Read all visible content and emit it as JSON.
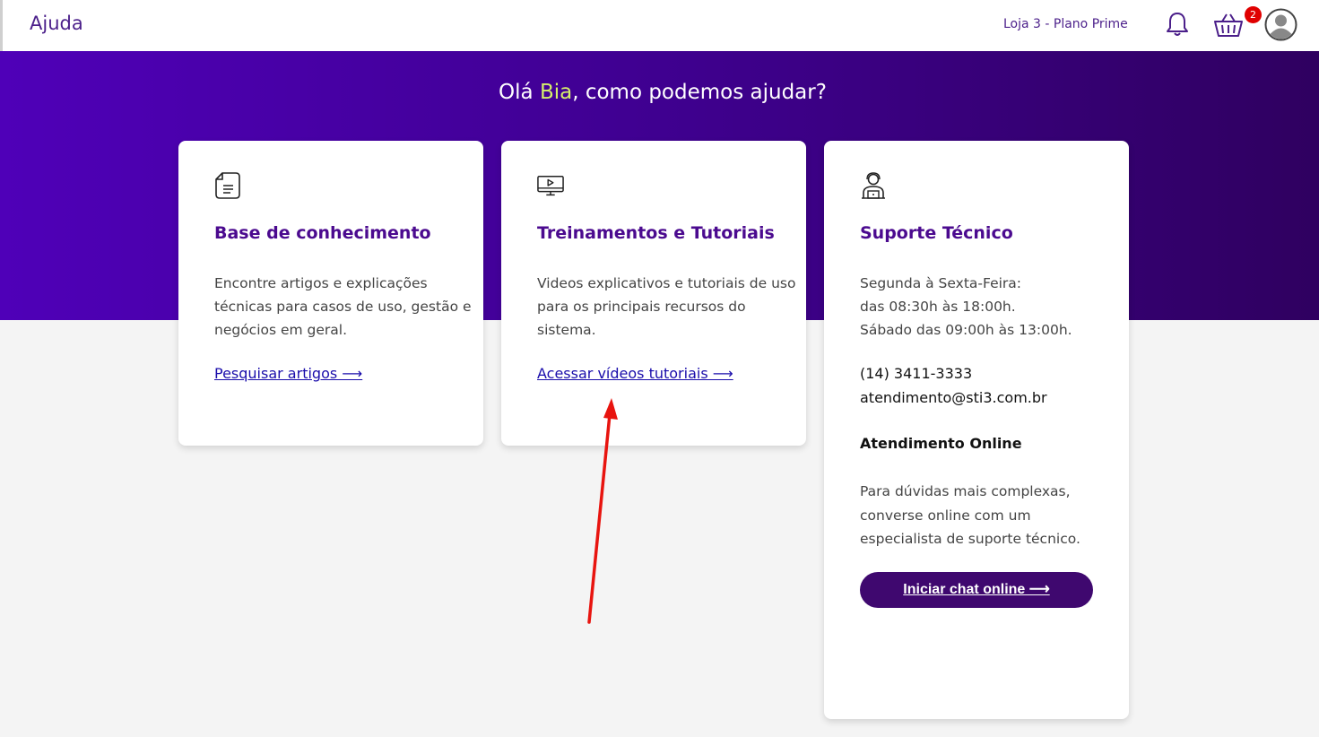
{
  "header": {
    "title": "Ajuda",
    "store_label": "Loja 3 - Plano Prime",
    "cart_count": "2",
    "accent_color": "#4b1f8a",
    "icons": [
      "bell-icon",
      "basket-icon",
      "avatar-icon"
    ]
  },
  "hero": {
    "greeting_prefix": "Olá ",
    "greeting_name": "Bia",
    "greeting_suffix": ", como podemos ajudar?",
    "gradient_colors": [
      "#4f00b8",
      "#2f0060"
    ]
  },
  "cards": {
    "knowledge": {
      "icon": "document-icon",
      "title": "Base de conhecimento",
      "description": "Encontre artigos e explicações técnicas para casos de uso, gestão e negócios em geral.",
      "link": "Pesquisar artigos ⟶"
    },
    "training": {
      "icon": "monitor-play-icon",
      "title": "Treinamentos e Tutoriais",
      "description": "Videos explicativos e tutoriais de uso para os principais recursos do sistema.",
      "link": "Acessar vídeos tutoriais ⟶"
    },
    "support": {
      "icon": "support-agent-icon",
      "title": "Suporte Técnico",
      "hours_line1": "Segunda à Sexta-Feira:",
      "hours_line2": "das 08:30h às 18:00h.",
      "hours_line3": "Sábado das 09:00h às 13:00h.",
      "phone": "(14) 3411-3333",
      "email": "atendimento@sti3.com.br",
      "online_title": "Atendimento Online",
      "online_description": "Para dúvidas mais complexas, converse online com um especialista de suporte técnico.",
      "chat_button": "Iniciar chat online ⟶"
    }
  },
  "annotation": {
    "color": "#e8140f"
  }
}
